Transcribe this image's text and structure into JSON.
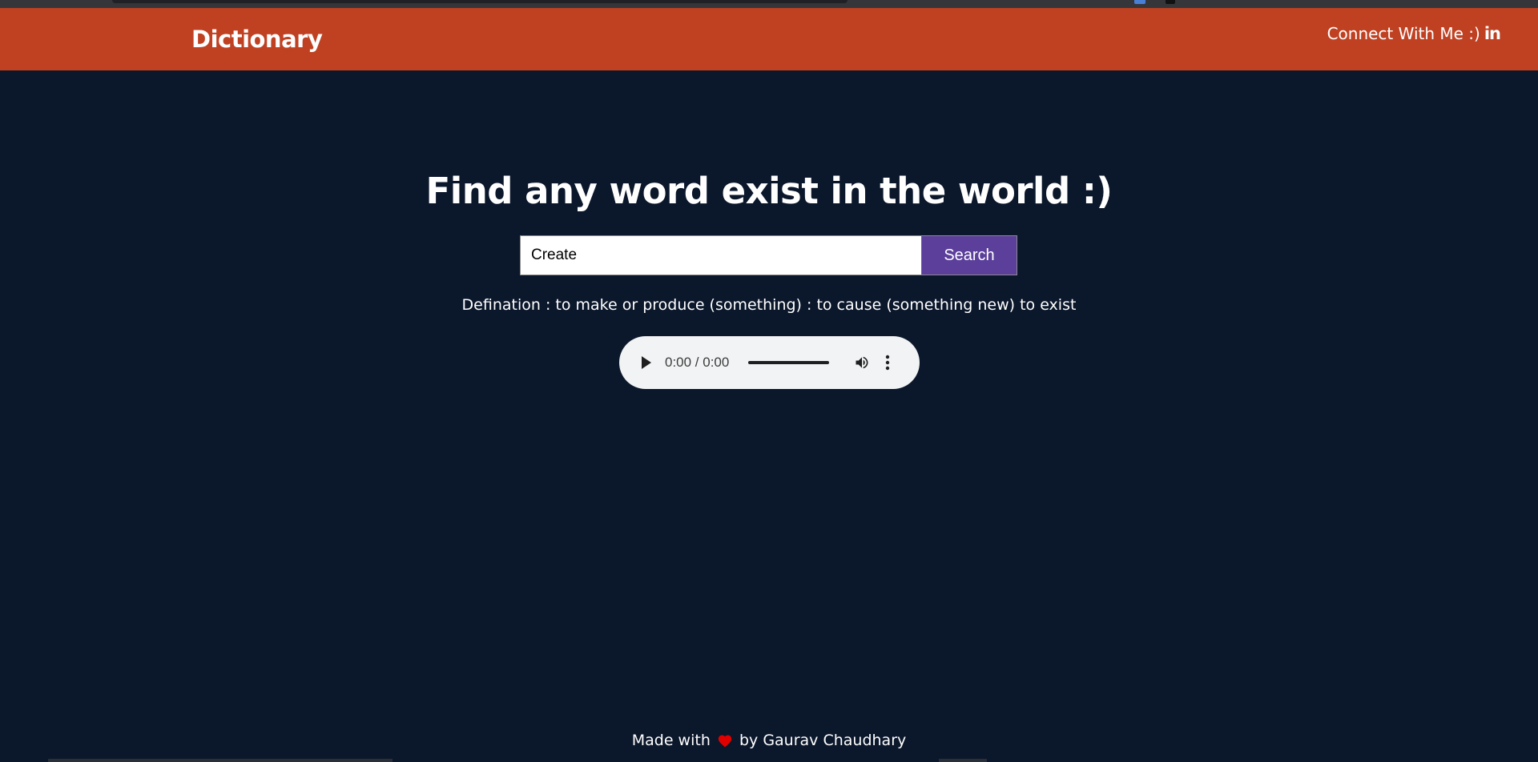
{
  "brand": {
    "title": "Dictionary"
  },
  "connect": {
    "label": "Connect With Me :)",
    "icon": "linkedin-icon",
    "icon_text": "in"
  },
  "hero": {
    "title": "Find any word exist in the world :)"
  },
  "search": {
    "value": "Create",
    "button_label": "Search"
  },
  "definition": {
    "text": "Defination : to make or produce (something) : to cause (something new) to exist"
  },
  "audio": {
    "time": "0:00 / 0:00",
    "progress": 0
  },
  "footer": {
    "prefix": "Made with",
    "suffix": "by Gaurav Chaudhary",
    "icon": "heart-icon"
  },
  "colors": {
    "navbar": "#bf4122",
    "background": "#0b172b",
    "search_button": "#5b3f9b",
    "heart": "#e00000"
  }
}
